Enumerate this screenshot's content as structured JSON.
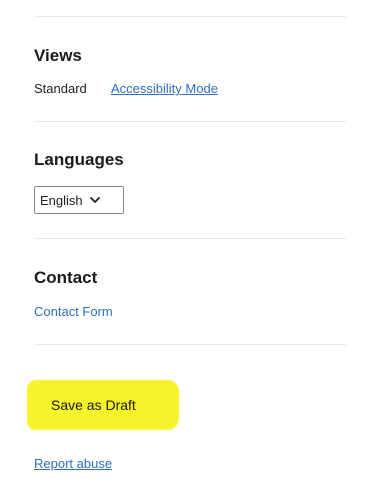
{
  "views": {
    "heading": "Views",
    "current": "Standard",
    "accessibility_link": "Accessibility Mode"
  },
  "languages": {
    "heading": "Languages",
    "selected": "English"
  },
  "contact": {
    "heading": "Contact",
    "form_link": "Contact Form"
  },
  "actions": {
    "save_draft_label": "Save as Draft",
    "report_abuse_label": "Report abuse"
  },
  "colors": {
    "link": "#2f6fc4",
    "highlight": "#f6f32a"
  },
  "icons": {
    "language_dropdown": "chevron-down-icon"
  }
}
